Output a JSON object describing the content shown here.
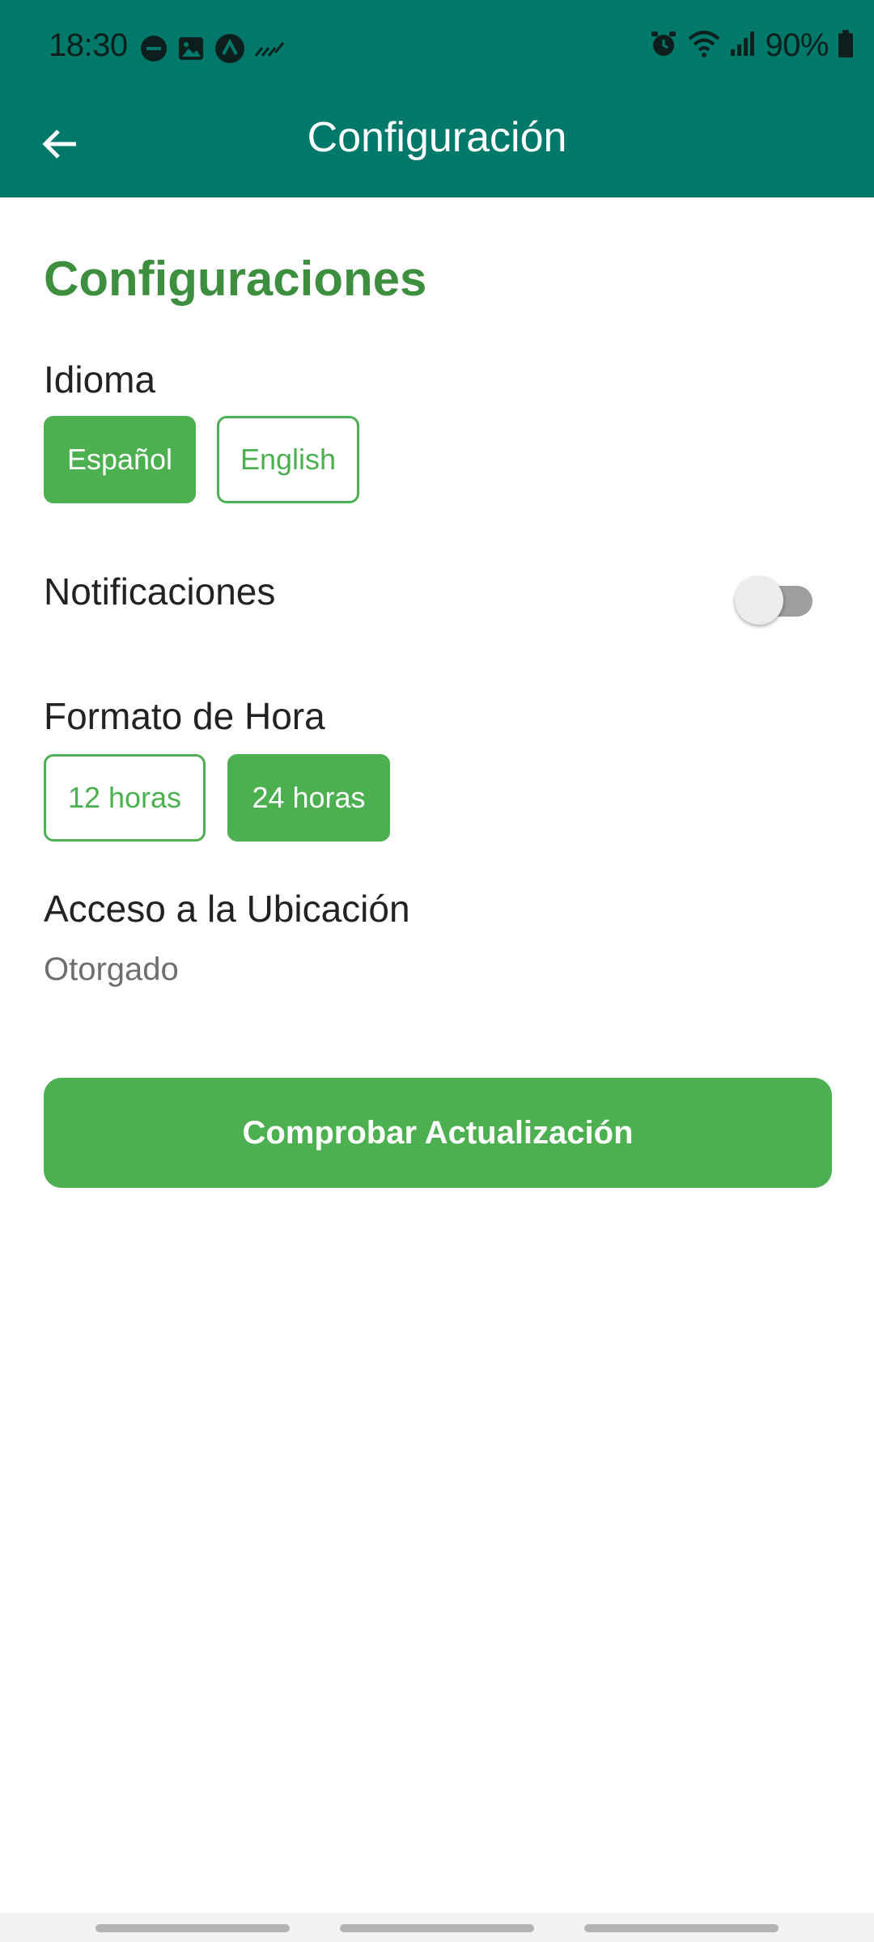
{
  "status_bar": {
    "time": "18:30",
    "battery_percent": "90%",
    "left_icons": [
      "do-not-disturb-icon",
      "image-icon",
      "app-icon",
      "stylus-icon"
    ],
    "right_icons": [
      "alarm-icon",
      "wifi-icon",
      "signal-icon",
      "battery-icon"
    ]
  },
  "toolbar": {
    "title": "Configuración",
    "back_icon": "arrow-back-icon"
  },
  "settings": {
    "heading": "Configuraciones",
    "language": {
      "label": "Idioma",
      "options": [
        {
          "label": "Español",
          "selected": true
        },
        {
          "label": "English",
          "selected": false
        }
      ]
    },
    "notifications": {
      "label": "Notificaciones",
      "enabled": false
    },
    "time_format": {
      "label": "Formato de Hora",
      "options": [
        {
          "label": "12 horas",
          "selected": false
        },
        {
          "label": "24 horas",
          "selected": true
        }
      ]
    },
    "location": {
      "label": "Acceso a la Ubicación",
      "value": "Otorgado"
    },
    "check_update_label": "Comprobar Actualización"
  },
  "colors": {
    "header": "#00796b",
    "accent": "#4caf50",
    "heading": "#3d8f3f"
  }
}
